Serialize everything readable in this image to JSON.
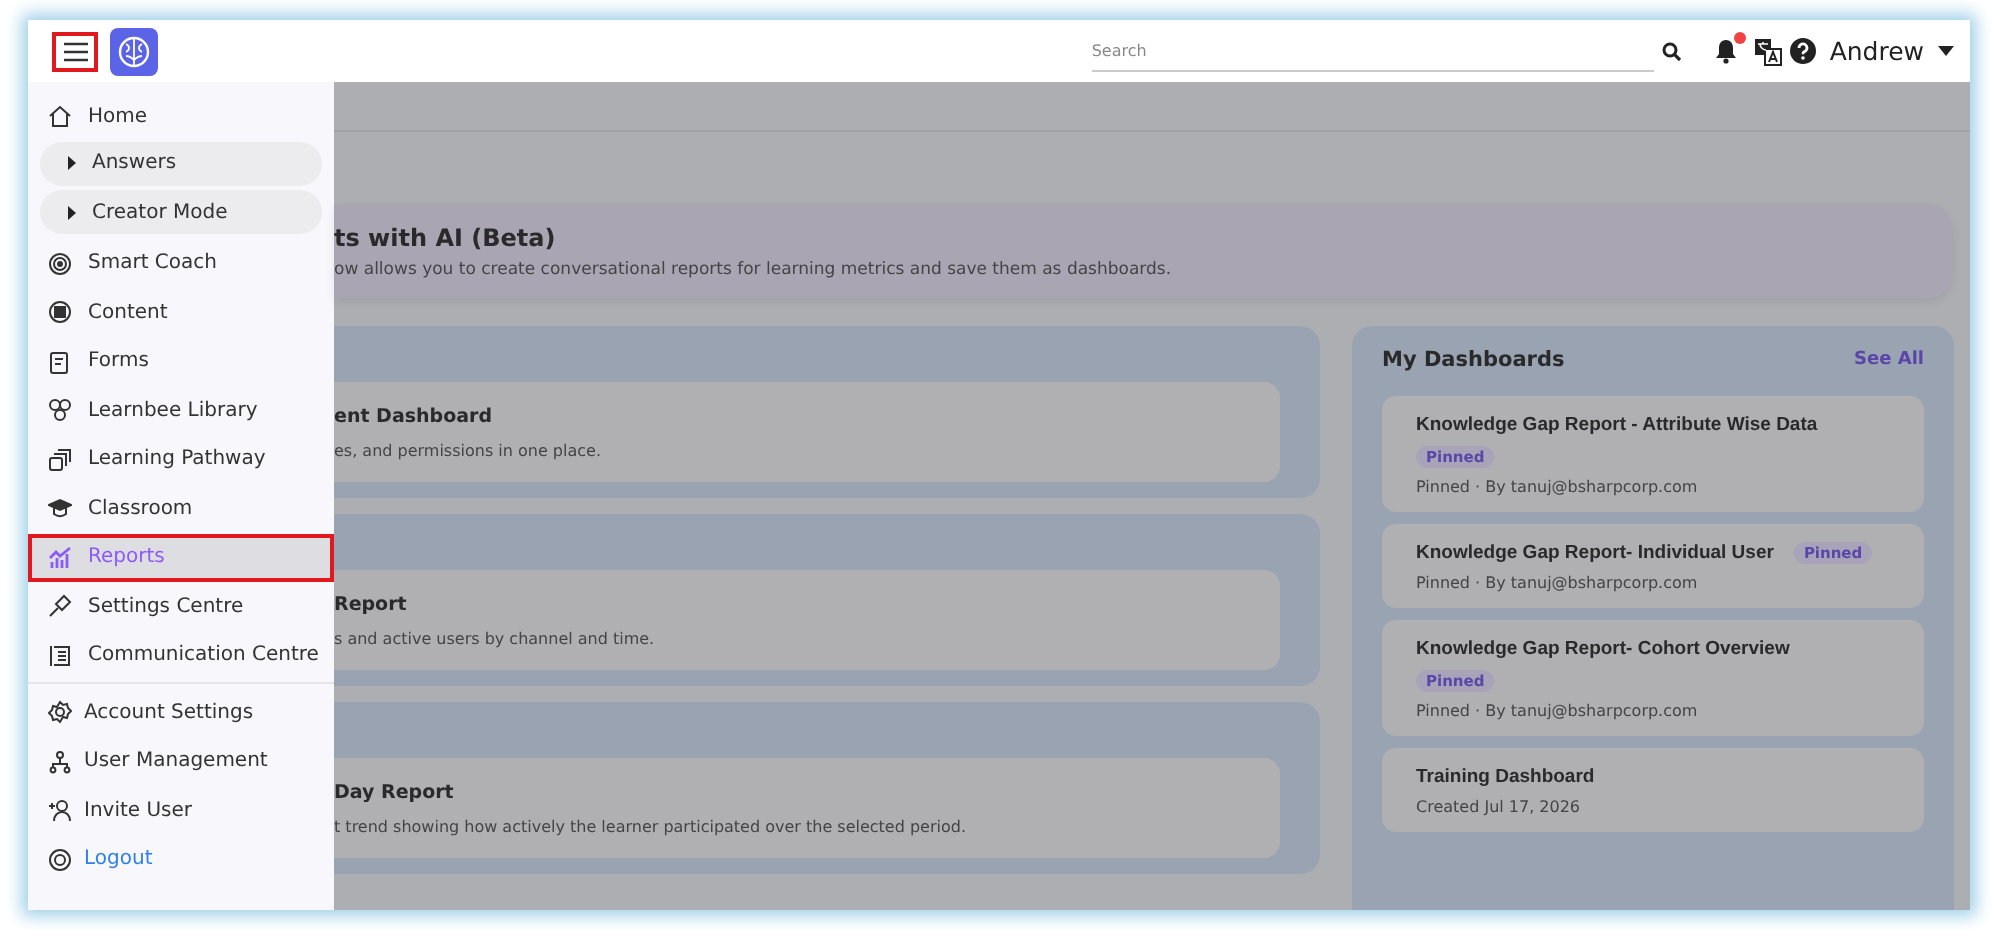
{
  "header": {
    "menu_button": {
      "highlighted": true
    },
    "search": {
      "placeholder": "Search"
    },
    "notifications": {
      "unread": true
    },
    "user": {
      "name": "Andrew"
    }
  },
  "sidebar": {
    "sections": [
      {
        "items": [
          {
            "label": "Home",
            "kind": "link",
            "selected": false,
            "highlighted": false
          },
          {
            "label": "Answers",
            "kind": "group",
            "expanded": false,
            "selected": false
          },
          {
            "label": "Creator Mode",
            "kind": "group",
            "expanded": false,
            "selected": false
          },
          {
            "label": "Smart Coach",
            "kind": "link",
            "selected": false,
            "highlighted": false
          },
          {
            "label": "Content",
            "kind": "link",
            "selected": false,
            "highlighted": false
          },
          {
            "label": "Forms",
            "kind": "link",
            "selected": false,
            "highlighted": false
          },
          {
            "label": "Learnbee Library",
            "kind": "link",
            "selected": false,
            "highlighted": false
          },
          {
            "label": "Learning Pathway",
            "kind": "link",
            "selected": false,
            "highlighted": false
          },
          {
            "label": "Classroom",
            "kind": "link",
            "selected": false,
            "highlighted": false
          },
          {
            "label": "Reports",
            "kind": "link",
            "selected": true,
            "highlighted": true
          },
          {
            "label": "Settings Centre",
            "kind": "link",
            "selected": false,
            "highlighted": false
          },
          {
            "label": "Communication Centre",
            "kind": "link",
            "selected": false,
            "highlighted": false
          }
        ]
      },
      {
        "items": [
          {
            "label": "Account Settings",
            "kind": "link",
            "selected": false,
            "highlighted": false
          },
          {
            "label": "User Management",
            "kind": "link",
            "selected": false,
            "highlighted": false
          },
          {
            "label": "Invite User",
            "kind": "link",
            "selected": false,
            "highlighted": false
          },
          {
            "label": "Logout",
            "kind": "logout",
            "selected": false,
            "highlighted": false
          }
        ]
      }
    ]
  },
  "banner": {
    "title": "ts with AI (Beta)",
    "description": "ow allows you to create conversational reports for learning metrics and save them as dashboards."
  },
  "report_cards": [
    {
      "title": "ent Dashboard",
      "description": "es, and permissions in one place."
    },
    {
      "title": "Report",
      "description": "s and active users by channel and time."
    },
    {
      "title": "Day Report",
      "description": "t trend showing how actively the learner participated over the selected period."
    }
  ],
  "my_dashboards": {
    "title": "My Dashboards",
    "see_all": "See All",
    "items": [
      {
        "title": "Knowledge Gap Report - Attribute Wise Data",
        "badge": "Pinned",
        "meta": "Pinned · By tanuj@bsharpcorp.com"
      },
      {
        "title": "Knowledge Gap Report- Individual User",
        "badge": "Pinned",
        "meta": "Pinned · By tanuj@bsharpcorp.com"
      },
      {
        "title": "Knowledge Gap Report- Cohort Overview",
        "badge": "Pinned",
        "meta": "Pinned · By tanuj@bsharpcorp.com"
      },
      {
        "title": "Training Dashboard",
        "meta": "Created Jul 17, 2026"
      }
    ]
  }
}
